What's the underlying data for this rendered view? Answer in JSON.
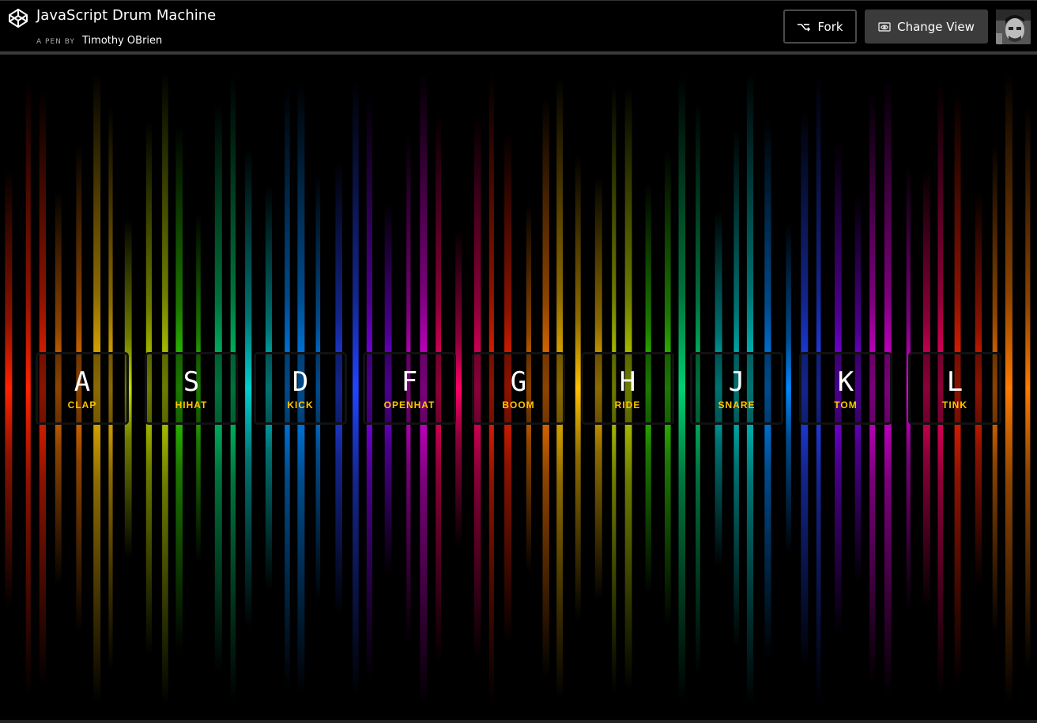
{
  "header": {
    "title": "JavaScript Drum Machine",
    "byline_prefix": "A PEN BY",
    "author": "Timothy OBrien",
    "fork_label": "Fork",
    "change_view_label": "Change View"
  },
  "keys": [
    {
      "letter": "A",
      "sound": "CLAP"
    },
    {
      "letter": "S",
      "sound": "HIHAT"
    },
    {
      "letter": "D",
      "sound": "KICK"
    },
    {
      "letter": "F",
      "sound": "OPENHAT"
    },
    {
      "letter": "G",
      "sound": "BOOM"
    },
    {
      "letter": "H",
      "sound": "RIDE"
    },
    {
      "letter": "J",
      "sound": "SNARE"
    },
    {
      "letter": "K",
      "sound": "TOM"
    },
    {
      "letter": "L",
      "sound": "TINK"
    }
  ],
  "colors": {
    "accent": "#ffc600",
    "background": "#000000",
    "spectrum": [
      "#ff2200",
      "#ff7a00",
      "#ffc000",
      "#c8e000",
      "#33dd00",
      "#00d070",
      "#00d0d0",
      "#0088ff",
      "#2244ff",
      "#8800ff",
      "#e000e0",
      "#ff0066"
    ]
  },
  "icons": {
    "logo": "codepen-logo-icon",
    "fork": "fork-icon",
    "change_view": "eye-icon",
    "avatar": "user-avatar"
  }
}
